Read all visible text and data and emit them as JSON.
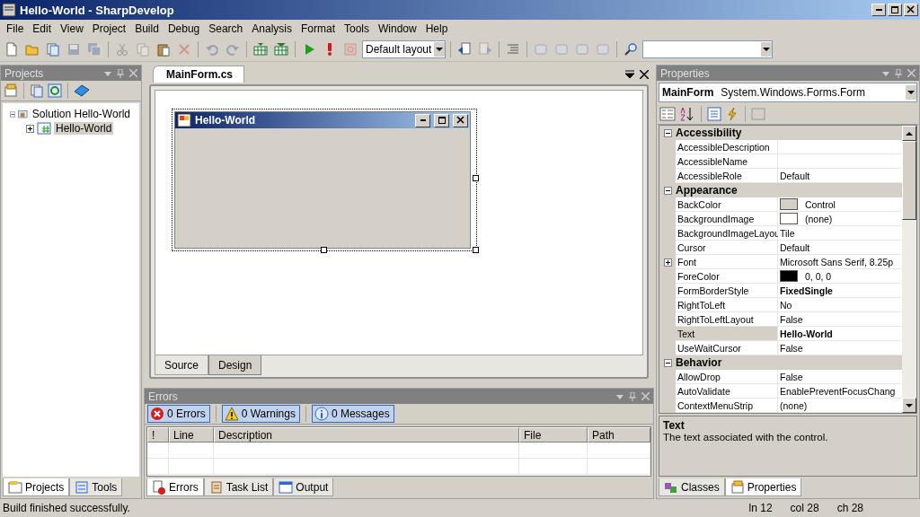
{
  "window": {
    "title": "Hello-World - SharpDevelop"
  },
  "menu": [
    "File",
    "Edit",
    "View",
    "Project",
    "Build",
    "Debug",
    "Search",
    "Analysis",
    "Format",
    "Tools",
    "Window",
    "Help"
  ],
  "toolbar": [
    {
      "kind": "new",
      "disabled": false
    },
    {
      "kind": "open",
      "disabled": false
    },
    {
      "kind": "add",
      "disabled": false
    },
    {
      "kind": "save",
      "disabled": true
    },
    {
      "kind": "saveall",
      "disabled": true
    },
    {
      "kind": "sep"
    },
    {
      "kind": "cut",
      "disabled": true
    },
    {
      "kind": "copy",
      "disabled": true
    },
    {
      "kind": "paste",
      "disabled": false
    },
    {
      "kind": "delete",
      "disabled": true
    },
    {
      "kind": "sep"
    },
    {
      "kind": "undo",
      "disabled": true
    },
    {
      "kind": "redo",
      "disabled": true
    },
    {
      "kind": "sep"
    },
    {
      "kind": "build",
      "disabled": false
    },
    {
      "kind": "rebuild",
      "disabled": false
    },
    {
      "kind": "sep"
    },
    {
      "kind": "run",
      "disabled": false
    },
    {
      "kind": "break",
      "disabled": false
    },
    {
      "kind": "stop",
      "disabled": true
    },
    {
      "kind": "layout",
      "value": "Default layout"
    },
    {
      "kind": "sep"
    },
    {
      "kind": "back",
      "disabled": false
    },
    {
      "kind": "forward",
      "disabled": true
    },
    {
      "kind": "sep"
    },
    {
      "kind": "outline",
      "disabled": false
    },
    {
      "kind": "sep"
    },
    {
      "kind": "bookmark",
      "disabled": true
    },
    {
      "kind": "bookmark",
      "disabled": true
    },
    {
      "kind": "bookmark",
      "disabled": true
    },
    {
      "kind": "bookmark",
      "disabled": true
    },
    {
      "kind": "sep"
    },
    {
      "kind": "find",
      "disabled": false
    },
    {
      "kind": "searchbox"
    }
  ],
  "projects": {
    "title": "Projects",
    "tree": [
      {
        "label": "Solution Hello-World",
        "selected": false,
        "expanded": true,
        "children": [
          {
            "label": "Hello-World",
            "selected": true,
            "expanded": false
          }
        ]
      }
    ],
    "tabs": [
      {
        "label": "Projects",
        "selected": true
      },
      {
        "label": "Tools",
        "selected": false
      }
    ]
  },
  "document": {
    "tabs": [
      {
        "label": "MainForm.cs",
        "selected": true
      }
    ],
    "form_title": "Hello-World",
    "view_tabs": [
      {
        "label": "Source",
        "selected": false
      },
      {
        "label": "Design",
        "selected": true
      }
    ]
  },
  "errors": {
    "title": "Errors",
    "filters": [
      {
        "kind": "error",
        "label": "0 Errors",
        "on": true
      },
      {
        "kind": "warning",
        "label": "0 Warnings",
        "on": true
      },
      {
        "kind": "info",
        "label": "0 Messages",
        "on": true
      }
    ],
    "columns": [
      "!",
      "Line",
      "Description",
      "File",
      "Path"
    ],
    "tabs": [
      {
        "kind": "errors",
        "label": "Errors",
        "selected": true
      },
      {
        "kind": "tasks",
        "label": "Task List",
        "selected": false
      },
      {
        "kind": "output",
        "label": "Output",
        "selected": false
      }
    ]
  },
  "properties": {
    "title": "Properties",
    "object_name": "MainForm",
    "object_type": "System.Windows.Forms.Form",
    "categories": [
      {
        "name": "Accessibility",
        "expanded": true,
        "rows": [
          {
            "name": "AccessibleDescription",
            "value": "",
            "selected": false
          },
          {
            "name": "AccessibleName",
            "value": "",
            "selected": false
          },
          {
            "name": "AccessibleRole",
            "value": "Default",
            "modified": false,
            "selected": false
          }
        ]
      },
      {
        "name": "Appearance",
        "expanded": true,
        "rows": [
          {
            "name": "BackColor",
            "value": "Control",
            "color": "#d4d0c8",
            "modified": false,
            "selected": false
          },
          {
            "name": "BackgroundImage",
            "value": "(none)",
            "color": "#ffffff",
            "modified": false,
            "selected": false
          },
          {
            "name": "BackgroundImageLayou",
            "value": "Tile",
            "modified": false,
            "selected": false
          },
          {
            "name": "Cursor",
            "value": "Default",
            "modified": false,
            "selected": false
          },
          {
            "name": "Font",
            "value": "Microsoft Sans Serif, 8.25p",
            "expanded": false,
            "modified": false,
            "selected": false
          },
          {
            "name": "ForeColor",
            "value": "0, 0, 0",
            "color": "#000000",
            "modified": false,
            "selected": false
          },
          {
            "name": "FormBorderStyle",
            "value": "FixedSingle",
            "modified": true,
            "selected": false
          },
          {
            "name": "RightToLeft",
            "value": "No",
            "modified": false,
            "selected": false
          },
          {
            "name": "RightToLeftLayout",
            "value": "False",
            "modified": false,
            "selected": false
          },
          {
            "name": "Text",
            "value": "Hello-World",
            "modified": true,
            "selected": true
          },
          {
            "name": "UseWaitCursor",
            "value": "False",
            "modified": false,
            "selected": false
          }
        ]
      },
      {
        "name": "Behavior",
        "expanded": true,
        "rows": [
          {
            "name": "AllowDrop",
            "value": "False",
            "modified": false,
            "selected": false
          },
          {
            "name": "AutoValidate",
            "value": "EnablePreventFocusChang",
            "modified": false,
            "selected": false
          },
          {
            "name": "ContextMenuStrip",
            "value": "(none)",
            "modified": false,
            "selected": false
          }
        ]
      }
    ],
    "description_title": "Text",
    "description": "The text associated with the control.",
    "tabs": [
      {
        "kind": "classes",
        "label": "Classes",
        "selected": false
      },
      {
        "kind": "properties",
        "label": "Properties",
        "selected": true
      }
    ]
  },
  "status_bar": {
    "message": "Build finished successfully.",
    "line": "ln 12",
    "column": "col 28",
    "char": "ch 28"
  }
}
